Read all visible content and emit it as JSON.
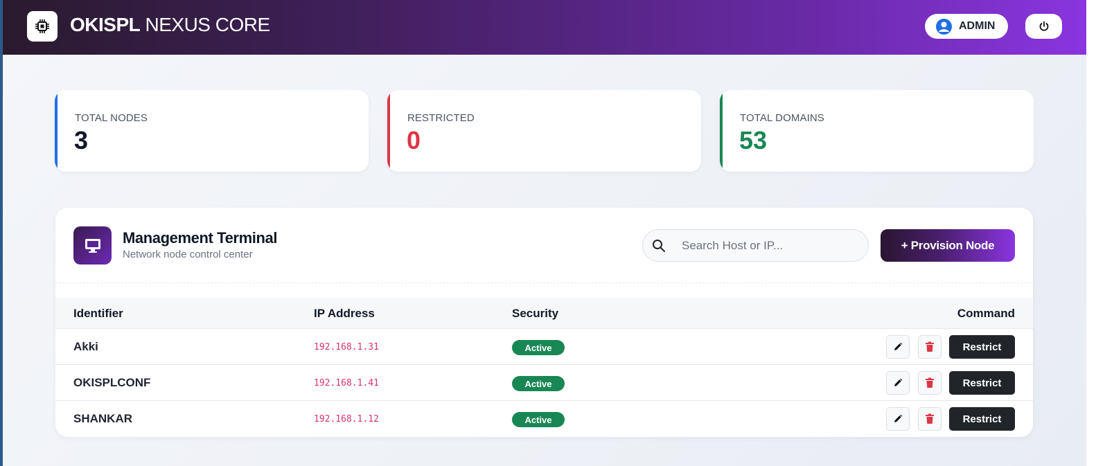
{
  "header": {
    "brand_bold": "OKISPL",
    "brand_light": "NEXUS CORE",
    "user_label": "ADMIN",
    "logo_icon": "chip-icon",
    "power_icon": "power-icon"
  },
  "stats": [
    {
      "label": "TOTAL NODES",
      "value": "3",
      "accent": "#1f6fe6",
      "color": "#111827"
    },
    {
      "label": "RESTRICTED",
      "value": "0",
      "accent": "#dc3545",
      "color": "#dc3545"
    },
    {
      "label": "TOTAL DOMAINS",
      "value": "53",
      "accent": "#198754",
      "color": "#198754"
    }
  ],
  "panel": {
    "title": "Management Terminal",
    "subtitle": "Network node control center",
    "icon": "monitor-icon",
    "search_placeholder": "Search Host or IP...",
    "provision_label": "+ Provision Node"
  },
  "table": {
    "headers": {
      "identifier": "Identifier",
      "ip": "IP Address",
      "security": "Security",
      "command": "Command"
    },
    "rows": [
      {
        "name": "Akki",
        "ip": "192.168.1.31",
        "status": "Active",
        "action": "Restrict"
      },
      {
        "name": "OKISPLCONF",
        "ip": "192.168.1.41",
        "status": "Active",
        "action": "Restrict"
      },
      {
        "name": "SHANKAR",
        "ip": "192.168.1.12",
        "status": "Active",
        "action": "Restrict"
      }
    ]
  },
  "colors": {
    "status_active": "#198754",
    "danger": "#dc3545",
    "ip_text": "#d6336c",
    "brand_gradient_end": "#8a35e0"
  }
}
